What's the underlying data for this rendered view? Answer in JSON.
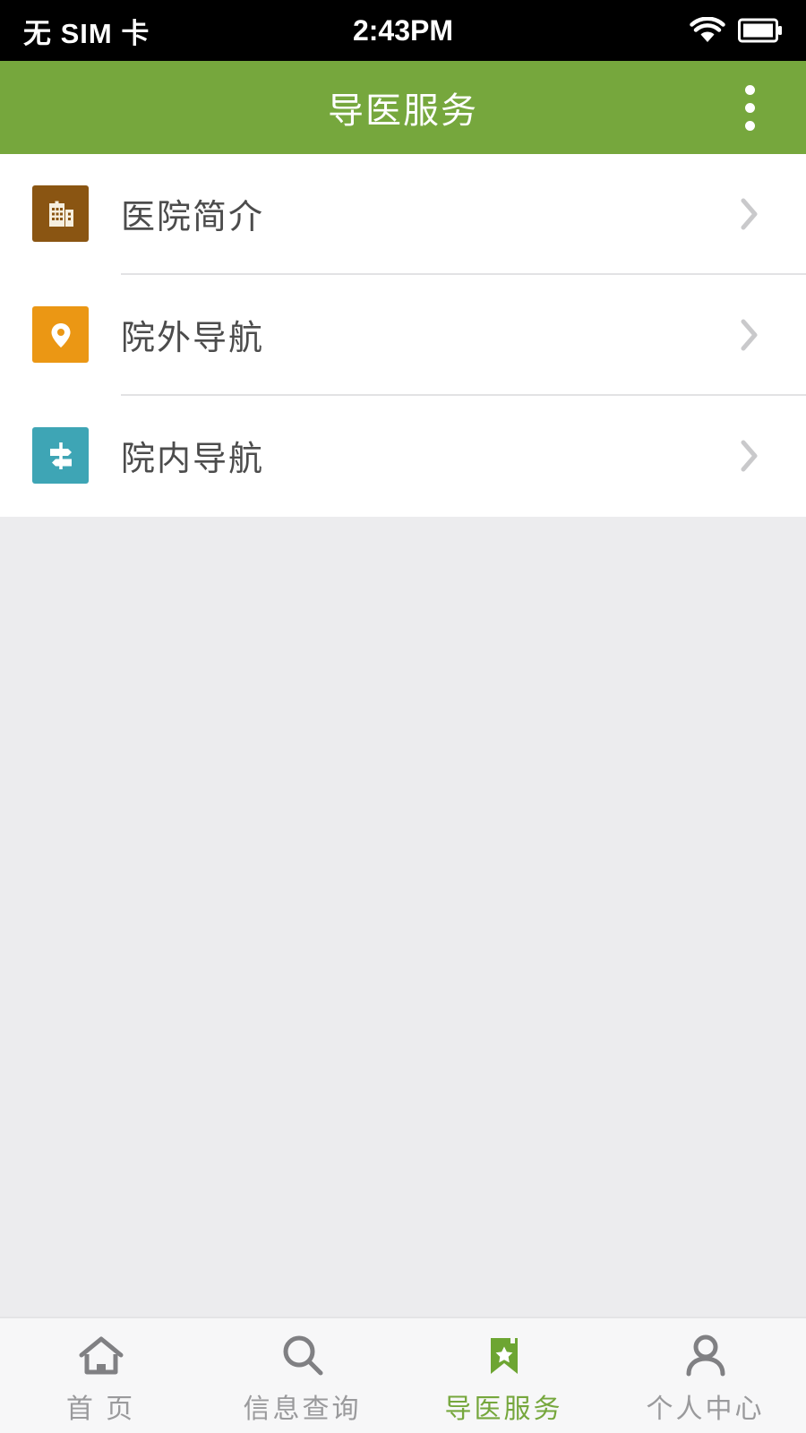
{
  "status_bar": {
    "carrier": "无 SIM 卡",
    "time": "2:43PM",
    "wifi_icon": "wifi-icon",
    "battery_icon": "battery-icon",
    "background_color": "#000000",
    "text_color": "#ffffff"
  },
  "header": {
    "title": "导医服务",
    "overflow_icon": "more-vertical-icon",
    "background_color": "#76a73d",
    "title_color": "#ffffff"
  },
  "list": {
    "items": [
      {
        "label": "医院简介",
        "icon": "hospital-building-icon",
        "tile_color": "#8a5512",
        "chevron": "chevron-right-icon"
      },
      {
        "label": "院外导航",
        "icon": "map-pin-icon",
        "tile_color": "#eb9714",
        "chevron": "chevron-right-icon"
      },
      {
        "label": "院内导航",
        "icon": "signpost-icon",
        "tile_color": "#3ea5b5",
        "chevron": "chevron-right-icon"
      }
    ],
    "divider_color": "#e2e2e4",
    "background_color": "#ffffff"
  },
  "content": {
    "background_color": "#ececee"
  },
  "tab_bar": {
    "active_color": "#76a73d",
    "inactive_color": "#9a9a9c",
    "background_color": "#f7f7f8",
    "items": [
      {
        "label": "首 页",
        "icon": "home-icon",
        "active": false
      },
      {
        "label": "信息查询",
        "icon": "search-icon",
        "active": false
      },
      {
        "label": "导医服务",
        "icon": "bookmark-star-icon",
        "active": true
      },
      {
        "label": "个人中心",
        "icon": "user-icon",
        "active": false
      }
    ]
  }
}
